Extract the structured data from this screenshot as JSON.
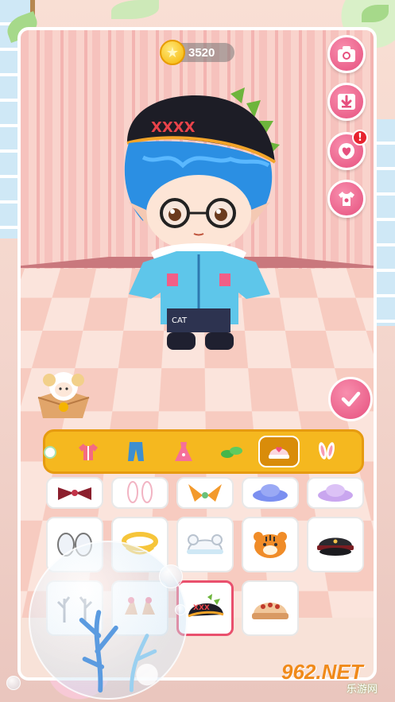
{
  "currency": {
    "coins": "3520",
    "icon": "coin-icon"
  },
  "side_buttons": [
    {
      "name": "camera-button",
      "icon": "camera-icon"
    },
    {
      "name": "save-button",
      "icon": "download-icon"
    },
    {
      "name": "favorite-button",
      "icon": "heart-icon",
      "badge": "!"
    },
    {
      "name": "wardrobe-button",
      "icon": "shirt-icon"
    }
  ],
  "confirm_icon": "check-icon",
  "categories": [
    {
      "name": "top",
      "icon": "shirt-icon"
    },
    {
      "name": "pants",
      "icon": "pants-icon"
    },
    {
      "name": "dress",
      "icon": "dress-icon"
    },
    {
      "name": "shoes",
      "icon": "shoes-icon"
    },
    {
      "name": "hat",
      "icon": "hat-icon",
      "active": true
    },
    {
      "name": "ears",
      "icon": "bunny-ears-icon"
    }
  ],
  "items": [
    "bow-accessory",
    "bunny-ears",
    "orange-ribbon",
    "blue-hat",
    "lilac-hat",
    "white-ear-muffs",
    "yellow-halo",
    "white-cat-hat",
    "tiger-hat",
    "black-cap",
    "deer-antlers",
    "pink-flower-ears",
    "black-dino-cap",
    "brown-beanie"
  ],
  "selected_item": "black-dino-cap",
  "colors": {
    "accent": "#e6507e",
    "category_bar": "#f5b81f",
    "selected_border": "#e9506d"
  },
  "watermark": {
    "main": "962.NET",
    "sub": "乐游网"
  }
}
